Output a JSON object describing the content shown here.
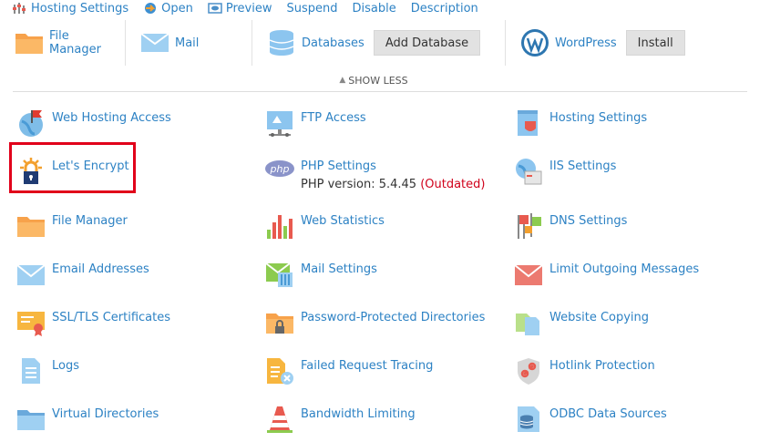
{
  "toolbar": [
    {
      "label": "Hosting Settings",
      "icon": "hosting-settings-icon"
    },
    {
      "label": "Open",
      "icon": "open-icon"
    },
    {
      "label": "Preview",
      "icon": "preview-icon"
    },
    {
      "label": "Suspend"
    },
    {
      "label": "Disable"
    },
    {
      "label": "Description"
    }
  ],
  "toprow": {
    "file_manager": {
      "line1": "File",
      "line2": "Manager"
    },
    "mail": "Mail",
    "databases": "Databases",
    "add_database": "Add Database",
    "wordpress": "WordPress",
    "install": "Install"
  },
  "show_less": "SHOW LESS",
  "tools": {
    "web_hosting_access": "Web Hosting Access",
    "ftp_access": "FTP Access",
    "hosting_settings": "Hosting Settings",
    "lets_encrypt": "Let's Encrypt",
    "php_settings": "PHP Settings",
    "php_version": "PHP version: 5.4.45",
    "php_outdated": "(Outdated)",
    "iis_settings": "IIS Settings",
    "file_manager": "File Manager",
    "web_statistics": "Web Statistics",
    "dns_settings": "DNS Settings",
    "email_addresses": "Email Addresses",
    "mail_settings": "Mail Settings",
    "limit_outgoing": "Limit Outgoing Messages",
    "ssl_tls": "SSL/TLS Certificates",
    "password_protected": "Password-Protected Directories",
    "website_copying": "Website Copying",
    "logs": "Logs",
    "failed_request_tracing": "Failed Request Tracing",
    "hotlink_protection": "Hotlink Protection",
    "virtual_directories": "Virtual Directories",
    "bandwidth_limiting": "Bandwidth Limiting",
    "odbc": "ODBC Data Sources"
  },
  "colors": {
    "link": "#2d82c4",
    "highlight": "#e1001a",
    "outdated": "#d0021b"
  }
}
